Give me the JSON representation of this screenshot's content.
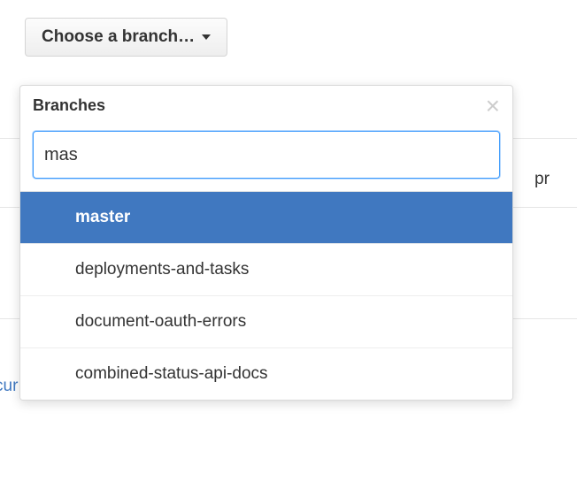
{
  "trigger": {
    "label": "Choose a branch…"
  },
  "popover": {
    "title": "Branches",
    "filter_value": "mas"
  },
  "branches": [
    {
      "name": "master",
      "selected": true
    },
    {
      "name": "deployments-and-tasks",
      "selected": false
    },
    {
      "name": "document-oauth-errors",
      "selected": false
    },
    {
      "name": "combined-status-api-docs",
      "selected": false
    }
  ],
  "background": {
    "right_fragment": "pr",
    "link_fragment": "cur"
  }
}
